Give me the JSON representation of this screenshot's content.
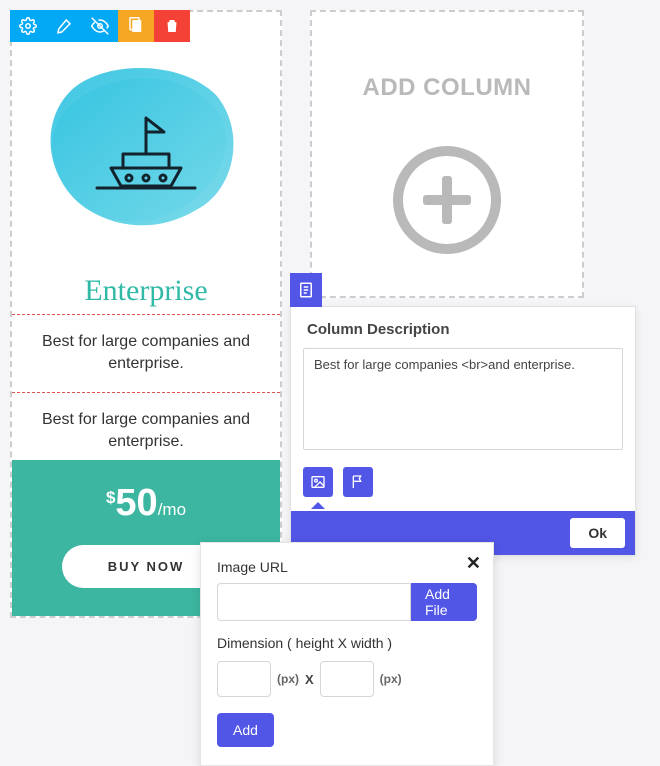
{
  "toolbar": {
    "icons": [
      "gear-icon",
      "brush-icon",
      "eye-off-icon",
      "clipboard-icon",
      "trash-icon"
    ]
  },
  "pricing_card": {
    "plan_name": "Enterprise",
    "desc1": "Best for large companies and enterprise.",
    "desc2": "Best for large companies and enterprise.",
    "currency": "$",
    "amount": "50",
    "period": "/mo",
    "cta": "BUY NOW"
  },
  "add_column": {
    "title": "ADD COLUMN"
  },
  "desc_editor": {
    "title": "Column Description",
    "value": "Best for large companies <br>and enterprise.",
    "ok": "Ok",
    "tool_icons": [
      "image-icon",
      "flag-icon"
    ]
  },
  "image_popup": {
    "url_label": "Image URL",
    "add_file": "Add File",
    "dim_label": "Dimension ( height X width )",
    "px": "(px)",
    "x": "X",
    "add": "Add",
    "url_value": "",
    "height_value": "",
    "width_value": ""
  }
}
